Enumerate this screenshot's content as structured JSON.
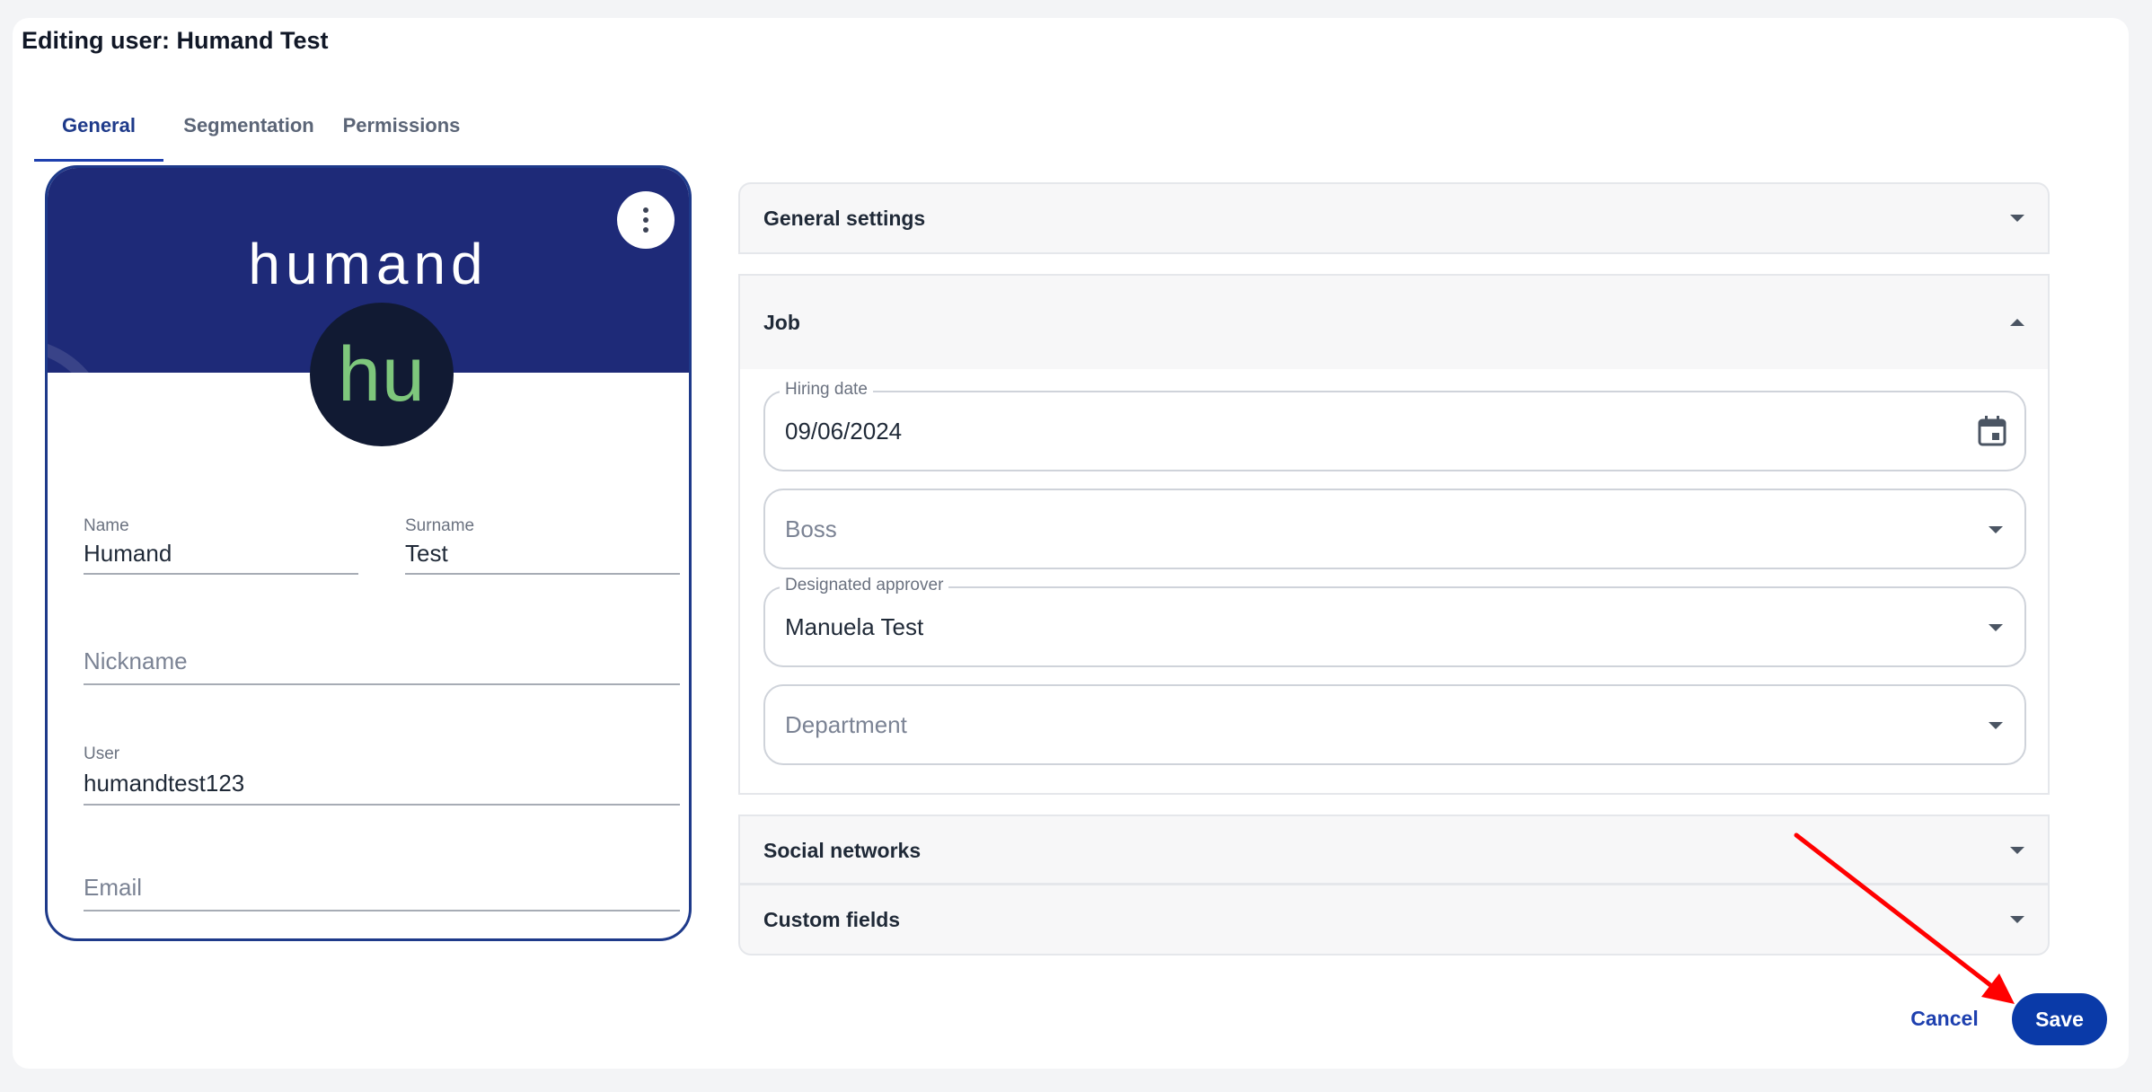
{
  "page": {
    "title": "Editing user: Humand Test"
  },
  "tabs": [
    {
      "label": "General",
      "active": true
    },
    {
      "label": "Segmentation",
      "active": false
    },
    {
      "label": "Permissions",
      "active": false
    }
  ],
  "profile": {
    "brand_wordmark": "humand",
    "avatar_initials": "hu",
    "menu_icon": "more-vertical-icon",
    "name": {
      "label": "Name",
      "value": "Humand"
    },
    "surname": {
      "label": "Surname",
      "value": "Test"
    },
    "nickname": {
      "placeholder": "Nickname",
      "value": ""
    },
    "user": {
      "label": "User",
      "value": "humandtest123"
    },
    "email": {
      "placeholder": "Email",
      "value": ""
    }
  },
  "sections": {
    "general_settings": {
      "title": "General settings",
      "expanded": false
    },
    "job": {
      "title": "Job",
      "expanded": true,
      "hiring_date": {
        "label": "Hiring date",
        "value": "09/06/2024",
        "icon": "calendar-icon"
      },
      "boss": {
        "placeholder": "Boss",
        "value": ""
      },
      "designated_approver": {
        "label": "Designated approver",
        "value": "Manuela Test"
      },
      "department": {
        "placeholder": "Department",
        "value": ""
      }
    },
    "social_networks": {
      "title": "Social networks",
      "expanded": false
    },
    "custom_fields": {
      "title": "Custom fields",
      "expanded": false
    }
  },
  "actions": {
    "cancel_label": "Cancel",
    "save_label": "Save"
  },
  "colors": {
    "primary": "#0a3aa8",
    "banner": "#1e2a78",
    "avatar_bg": "#111a33",
    "avatar_text": "#7ec77c",
    "annotation_arrow": "#ff0000"
  }
}
